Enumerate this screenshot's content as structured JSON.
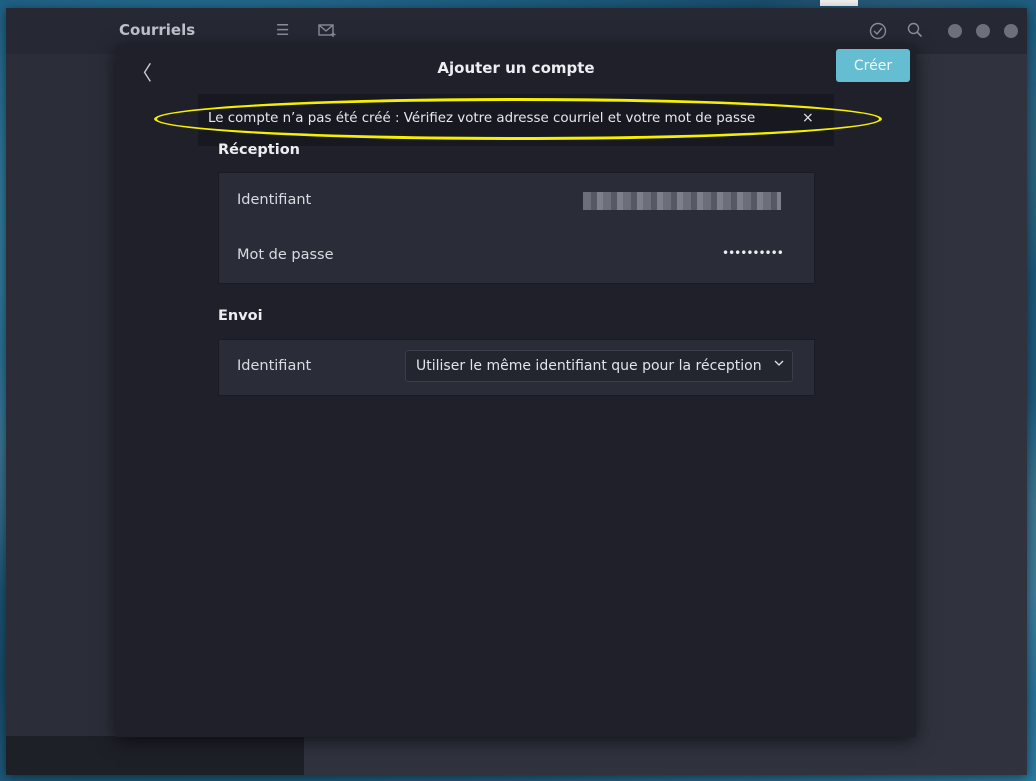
{
  "app": {
    "title": "Courriels"
  },
  "dialog": {
    "title": "Ajouter un compte",
    "create_label": "Créer"
  },
  "error": {
    "message": "Le compte n’a pas été créé : Vérifiez votre adresse courriel et votre mot de passe",
    "close_glyph": "×"
  },
  "reception": {
    "section_title": "Réception",
    "identifier_label": "Identifiant",
    "password_label": "Mot de passe",
    "password_value": "••••••••••"
  },
  "sending": {
    "section_title": "Envoi",
    "identifier_label": "Identifiant",
    "identifier_option": "Utiliser le même identifiant que pour la réception"
  },
  "colors": {
    "accent": "#64bdd0",
    "highlight": "#f4f000",
    "dialog_bg": "#1f2029"
  }
}
